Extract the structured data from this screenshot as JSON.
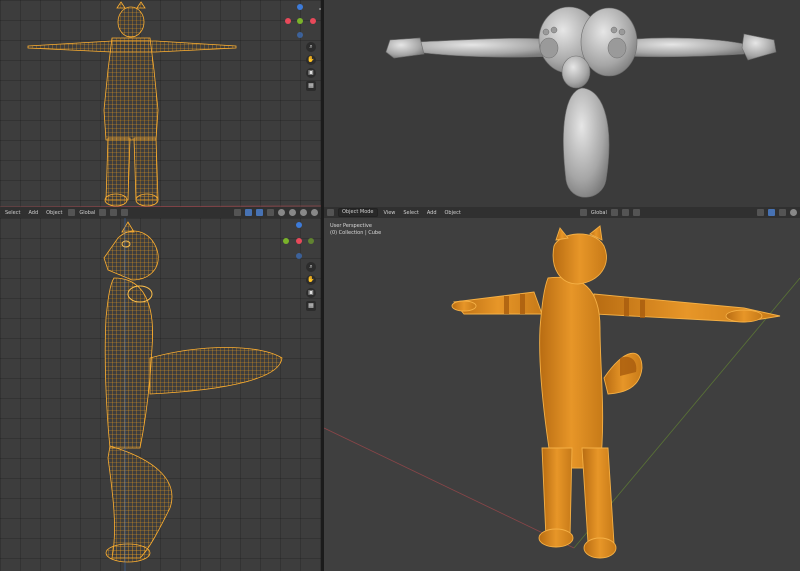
{
  "colors": {
    "mesh_wire": "#f0a020",
    "mesh_solid": "#d88a22",
    "mesh_gray": "#a9a9a9",
    "axis_x": "#e8495a",
    "axis_y": "#7ab32a",
    "axis_z": "#3d7bd9"
  },
  "viewport_bottom_right": {
    "header": {
      "mode_label": "Object Mode",
      "menus": [
        "View",
        "Select",
        "Add",
        "Object"
      ],
      "transform_orientation": "Global"
    },
    "overlay": {
      "view_name": "User Perspective",
      "collection_info": "(0) Collection | Cube"
    }
  },
  "viewport_bottom_left": {
    "header": {
      "menus": [
        "Select",
        "Add",
        "Object"
      ],
      "transform_orientation": "Global"
    }
  },
  "nav_icons": [
    "zoom-icon",
    "pan-hand-icon",
    "camera-icon",
    "grid-icon"
  ]
}
